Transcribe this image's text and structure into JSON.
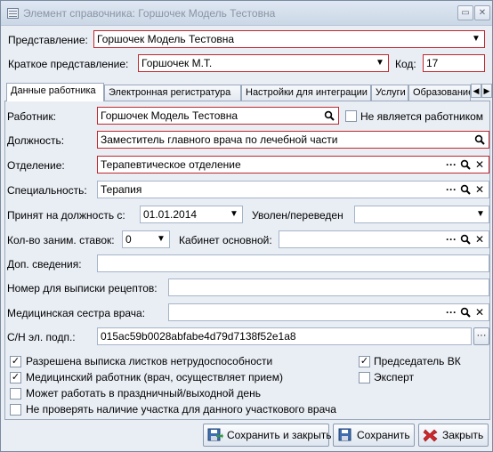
{
  "window": {
    "title": "Элемент справочника: Горшочек Модель Тестовна"
  },
  "header": {
    "representation_label": "Представление:",
    "representation_value": "Горшочек Модель Тестовна",
    "short_label": "Краткое представление:",
    "short_value": "Горшочек М.Т.",
    "code_label": "Код:",
    "code_value": "17"
  },
  "tabs": [
    {
      "label": "Данные работника"
    },
    {
      "label": "Электронная регистратура"
    },
    {
      "label": "Настройки для интеграции"
    },
    {
      "label": "Услуги"
    },
    {
      "label": "Образование"
    }
  ],
  "form": {
    "worker_label": "Работник:",
    "worker_value": "Горшочек Модель Тестовна",
    "not_worker_label": "Не является работником",
    "position_label": "Должность:",
    "position_value": "Заместитель главного врача по лечебной части",
    "department_label": "Отделение:",
    "department_value": "Терапевтическое отделение",
    "specialty_label": "Специальность:",
    "specialty_value": "Терапия",
    "hired_label": "Принят на должность с:",
    "hired_value": "01.01.2014",
    "fired_label": "Уволен/переведен",
    "fired_value": "",
    "rates_label": "Кол-во заним. ставок:",
    "rates_value": "0",
    "cabinet_label": "Кабинет основной:",
    "cabinet_value": "",
    "extra_label": "Доп. сведения:",
    "extra_value": "",
    "prescription_label": "Номер для выписки рецептов:",
    "prescription_value": "",
    "nurse_label": "Медицинская сестра врача:",
    "nurse_value": "",
    "sn_label": "С/Н эл. подп.:",
    "sn_value": "015ac59b0028abfabe4d79d7138f52e1a8"
  },
  "checkboxes": {
    "sick_leave": {
      "label": "Разрешена выписка листков нетрудоспособности",
      "checked": true
    },
    "medical_worker": {
      "label": "Медицинский работник (врач, осуществляет прием)",
      "checked": true
    },
    "holiday_work": {
      "label": "Может работать в праздничный/выходной день",
      "checked": false
    },
    "no_area_check": {
      "label": "Не проверять наличие участка для данного участкового врача",
      "checked": false
    },
    "vk_chair": {
      "label": "Председатель ВК",
      "checked": true
    },
    "expert": {
      "label": "Эксперт",
      "checked": false
    }
  },
  "buttons": {
    "save_close": "Сохранить и закрыть",
    "save": "Сохранить",
    "close": "Закрыть"
  },
  "colors": {
    "required_border": "#c0272d",
    "window_bg": "#e9eef5"
  }
}
